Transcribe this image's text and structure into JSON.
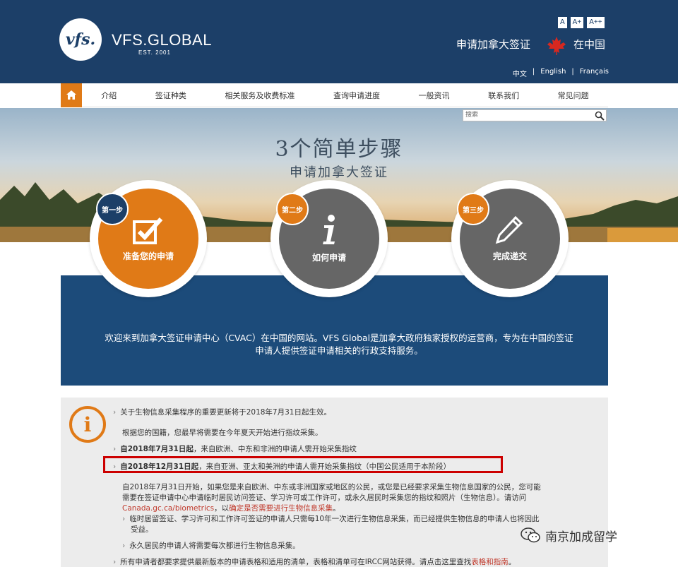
{
  "header": {
    "logo_mark": "vfs.",
    "brand": "VFS.GLOBAL",
    "est": "EST. 2001",
    "font_sizes": [
      "A",
      "A+",
      "A++"
    ],
    "apply_title": "申请加拿大签证",
    "region": "在中国",
    "languages": [
      "中文",
      "English",
      "Français"
    ]
  },
  "nav": {
    "items": [
      "介绍",
      "签证种类",
      "相关服务及收费标准",
      "查询申请进度",
      "一般资讯",
      "联系我们",
      "常见问题"
    ]
  },
  "search": {
    "placeholder": "搜索"
  },
  "hero": {
    "title": "3个简单步骤",
    "subtitle": "申请加拿大签证"
  },
  "steps": [
    {
      "badge": "第一步",
      "label": "准备您的申请",
      "icon": "checkbox-icon"
    },
    {
      "badge": "第二步",
      "label": "如何申请",
      "icon": "info-icon"
    },
    {
      "badge": "第三步",
      "label": "完成递交",
      "icon": "pencil-icon"
    }
  ],
  "welcome": {
    "line1": "欢迎来到加拿大签证申请中心（CVAC）在中国的网站。VFS Global是加拿大政府独家授权的运营商，专为在中国的签证",
    "line2": "申请人提供签证申请相关的行政支持服务。"
  },
  "notice": {
    "l1": "关于生物信息采集程序的重要更新将于2018年7月31日起生效。",
    "l2": "根据您的国籍，您最早将需要在今年夏天开始进行指纹采集。",
    "l3_bold": "自2018年7月31日起",
    "l3_rest": "，来自欧洲、中东和非洲的申请人需开始采集指纹",
    "l4_bold": "自2018年12月31日起",
    "l4_rest": "，来自亚洲、亚太和美洲的申请人需开始采集指纹（中国公民适用于本阶段）",
    "l5": "自2018年7月31日开始，如果您是来自欧洲、中东或非洲国家或地区的公民，或您是已经要求采集生物信息国家的公民，您可能",
    "l6": "需要在签证申请中心申请临时居民访问签证、学习许可或工作许可，或永久居民时采集您的指纹和照片（生物信息）。请访问",
    "l7_link": "Canada.gc.ca/biometrics",
    "l7_mid": "，以",
    "l7_link2": "确定是否需要进行生物信息采集",
    "l7_end": "。",
    "l8": "临时居留签证、学习许可和工作许可签证的申请人只需每10年一次进行生物信息采集，而已经提供生物信息的申请人也将因此",
    "l9": "受益。",
    "l10": "永久居民的申请人将需要每次都进行生物信息采集。",
    "l11": "所有申请者都要求提供最新版本的申请表格和适用的清单，表格和清单可在IRCC网站获得。请点击这里查找",
    "l11_link": "表格和指南",
    "l11_end": "。"
  },
  "watermark": "南京加成留学",
  "colors": {
    "navy": "#1c3f68",
    "orange": "#e07a17",
    "grey": "#666666",
    "red": "#cc0000"
  }
}
